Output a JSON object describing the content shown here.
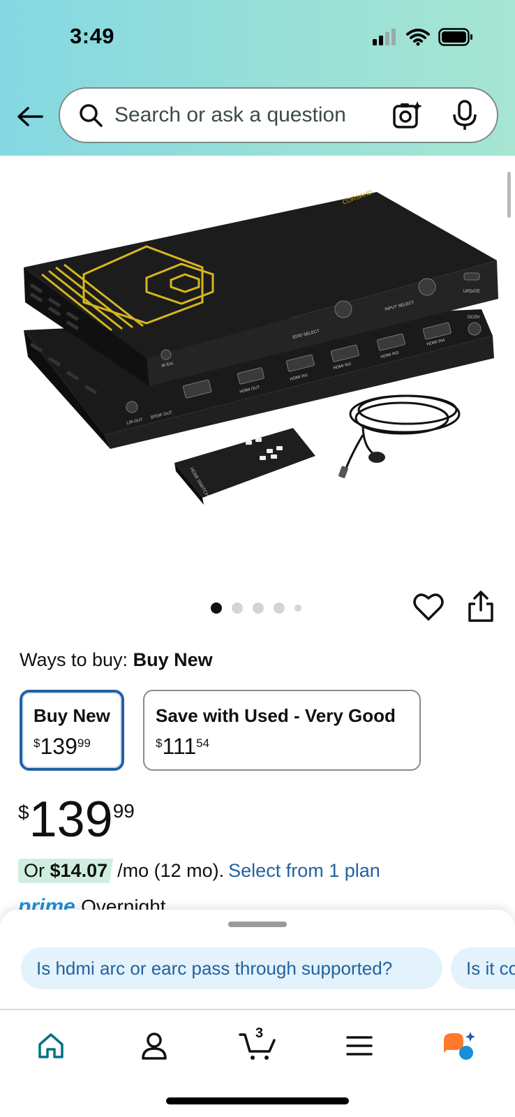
{
  "status_bar": {
    "time": "3:49"
  },
  "search": {
    "placeholder": "Search or ask a question"
  },
  "product_image": {
    "brand": "CORSAHD",
    "model_line_1": "CG-SW41H21A-EO",
    "model_line_2": "8K@60Hz/4K@120Hz/4:4:4 HDR",
    "model_line_3": "8K HDMI2.1 SWITCH 4X1 + eARC",
    "ports": [
      "HDMI IN1",
      "HDMI IN2",
      "HDMI IN3",
      "HDMI IN4",
      "HDMI OUT",
      "L/R OUT",
      "SPDIF OUT",
      "IR Ext.",
      "DC/5V",
      "UPDATE"
    ],
    "panel_labels": [
      "ATMOS CH7.1",
      "SPDIF CH5.1",
      "FIX EDID 4K7.1",
      "COPY",
      "EDID SELECT",
      "INPUT SELECT",
      "AUDIO SOURCE",
      "AUDIO DEVICE"
    ],
    "remote_label": "HDMI SWITCH"
  },
  "carousel": {
    "dot_count": 5,
    "active_index": 0
  },
  "ways_to_buy": {
    "label": "Ways to buy:",
    "selected": "Buy New"
  },
  "options": [
    {
      "label": "Buy New",
      "currency": "$",
      "whole": "139",
      "cents": "99",
      "selected": true
    },
    {
      "label": "Save with Used - Very Good",
      "currency": "$",
      "whole": "111",
      "cents": "54",
      "selected": false
    }
  ],
  "price": {
    "currency": "$",
    "whole": "139",
    "cents": "99"
  },
  "installment": {
    "prefix": "Or",
    "amount": "$14.07",
    "term": "/mo (12 mo).",
    "link": "Select from 1 plan"
  },
  "delivery": {
    "prime": "prime",
    "text": "Overnight"
  },
  "questions": [
    "Is hdmi arc or earc pass through supported?",
    "Is it co"
  ],
  "tabbar": {
    "cart_count": "3"
  },
  "colors": {
    "accent": "#2162a1",
    "installment_bg": "#cfeee0",
    "chip_bg": "#e3f2fb",
    "home_icon": "#007185"
  }
}
